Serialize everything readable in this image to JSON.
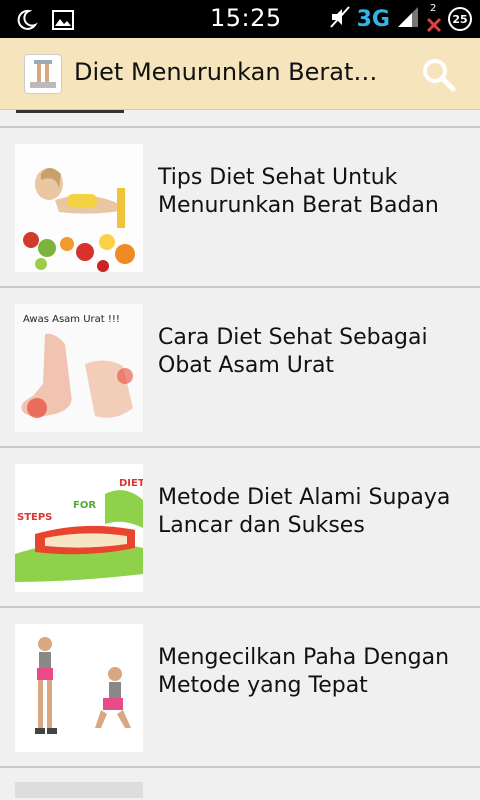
{
  "status_bar": {
    "time": "15:25",
    "network": "3G",
    "badge": "25",
    "notif_count": "2"
  },
  "action_bar": {
    "title": "Diet Menurunkan Berat…"
  },
  "articles": [
    {
      "title": "Tips Diet Sehat Untuk Menurunkan Berat Badan"
    },
    {
      "title": "Cara Diet Sehat Sebagai Obat Asam Urat",
      "image_caption": "Awas Asam Urat !!!"
    },
    {
      "title": "Metode Diet Alami Supaya Lancar dan Sukses",
      "image_words": [
        "DIET",
        "FOR",
        "STEPS"
      ]
    },
    {
      "title": "Mengecilkan Paha Dengan Metode yang Tepat"
    }
  ],
  "colors": {
    "action_bar_bg": "#f5e4bc",
    "list_bg": "#f0f0f0",
    "network_3g": "#33b5e5"
  }
}
